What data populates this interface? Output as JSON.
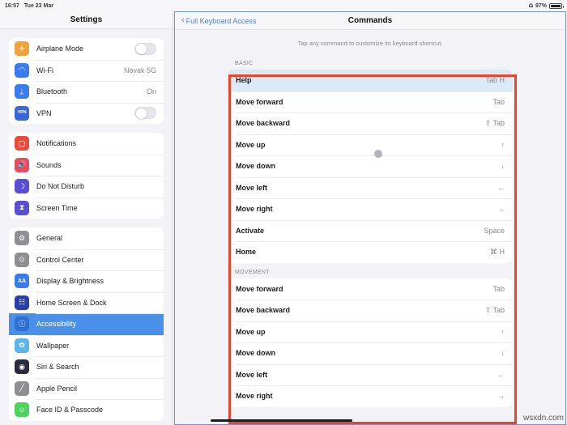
{
  "status_bar": {
    "time": "16:57",
    "date": "Tue 23 Mar",
    "wifi_icon": "wifi-icon",
    "battery_percent": "97%",
    "battery_icon": "battery-icon"
  },
  "sidebar": {
    "title": "Settings",
    "groups": [
      {
        "items": [
          {
            "label": "Airplane Mode",
            "icon": "airplane-icon",
            "icon_color": "#f0a33c",
            "glyph": "✈",
            "control": "toggle",
            "value": ""
          },
          {
            "label": "Wi-Fi",
            "icon": "wifi-icon",
            "icon_color": "#3a7bf0",
            "glyph": "◠",
            "control": "value",
            "value": "Novak 5G"
          },
          {
            "label": "Bluetooth",
            "icon": "bluetooth-icon",
            "icon_color": "#3a7bf0",
            "glyph": "ᛦ",
            "control": "value",
            "value": "On"
          },
          {
            "label": "VPN",
            "icon": "vpn-icon",
            "icon_color": "#3a66d6",
            "glyph": "VPN",
            "control": "toggle",
            "value": ""
          }
        ]
      },
      {
        "items": [
          {
            "label": "Notifications",
            "icon": "notifications-icon",
            "icon_color": "#eb4b3c",
            "glyph": "▢",
            "control": "none",
            "value": ""
          },
          {
            "label": "Sounds",
            "icon": "sounds-icon",
            "icon_color": "#ea4b60",
            "glyph": "🔊",
            "control": "none",
            "value": ""
          },
          {
            "label": "Do Not Disturb",
            "icon": "do-not-disturb-icon",
            "icon_color": "#5a4ed6",
            "glyph": "☽",
            "control": "none",
            "value": ""
          },
          {
            "label": "Screen Time",
            "icon": "screen-time-icon",
            "icon_color": "#5a4ed6",
            "glyph": "⧗",
            "control": "none",
            "value": ""
          }
        ]
      },
      {
        "items": [
          {
            "label": "General",
            "icon": "general-gear-icon",
            "icon_color": "#8e8e93",
            "glyph": "⚙",
            "control": "none",
            "value": ""
          },
          {
            "label": "Control Center",
            "icon": "control-center-icon",
            "icon_color": "#8e8e93",
            "glyph": "⊙",
            "control": "none",
            "value": ""
          },
          {
            "label": "Display & Brightness",
            "icon": "display-brightness-icon",
            "icon_color": "#3a7bf0",
            "glyph": "AA",
            "control": "none",
            "value": ""
          },
          {
            "label": "Home Screen & Dock",
            "icon": "home-screen-dock-icon",
            "icon_color": "#2b3fa8",
            "glyph": "☷",
            "control": "none",
            "value": ""
          },
          {
            "label": "Accessibility",
            "icon": "accessibility-icon",
            "icon_color": "#2f6fd0",
            "glyph": "ⓘ",
            "control": "none",
            "value": "",
            "selected": true
          },
          {
            "label": "Wallpaper",
            "icon": "wallpaper-icon",
            "icon_color": "#5ab5e8",
            "glyph": "✿",
            "control": "none",
            "value": ""
          },
          {
            "label": "Siri & Search",
            "icon": "siri-search-icon",
            "icon_color": "#2a2a3e",
            "glyph": "◉",
            "control": "none",
            "value": ""
          },
          {
            "label": "Apple Pencil",
            "icon": "apple-pencil-icon",
            "icon_color": "#8e8e93",
            "glyph": "╱",
            "control": "none",
            "value": ""
          },
          {
            "label": "Face ID & Passcode",
            "icon": "face-id-icon",
            "icon_color": "#4cd35f",
            "glyph": "☺",
            "control": "none",
            "value": ""
          }
        ]
      }
    ]
  },
  "detail": {
    "back_label": "Full Keyboard Access",
    "back_icon": "chevron-left-icon",
    "title": "Commands",
    "hint": "Tap any command to customize its keyboard shortcut.",
    "sections": [
      {
        "header": "BASIC",
        "rows": [
          {
            "label": "Help",
            "shortcut": "Tab H",
            "highlight": true
          },
          {
            "label": "Move forward",
            "shortcut": "Tab"
          },
          {
            "label": "Move backward",
            "shortcut": "⇧ Tab"
          },
          {
            "label": "Move up",
            "shortcut": "↑"
          },
          {
            "label": "Move down",
            "shortcut": "↓"
          },
          {
            "label": "Move left",
            "shortcut": "←"
          },
          {
            "label": "Move right",
            "shortcut": "→"
          },
          {
            "label": "Activate",
            "shortcut": "Space"
          },
          {
            "label": "Home",
            "shortcut": "⌘ H"
          }
        ]
      },
      {
        "header": "MOVEMENT",
        "rows": [
          {
            "label": "Move forward",
            "shortcut": "Tab"
          },
          {
            "label": "Move backward",
            "shortcut": "⇧ Tab"
          },
          {
            "label": "Move up",
            "shortcut": "↑"
          },
          {
            "label": "Move down",
            "shortcut": "↓"
          },
          {
            "label": "Move left",
            "shortcut": "←"
          },
          {
            "label": "Move right",
            "shortcut": "→"
          }
        ]
      }
    ]
  },
  "annotation": {
    "color": "#e8452b"
  },
  "watermark": "wsxdn.com"
}
